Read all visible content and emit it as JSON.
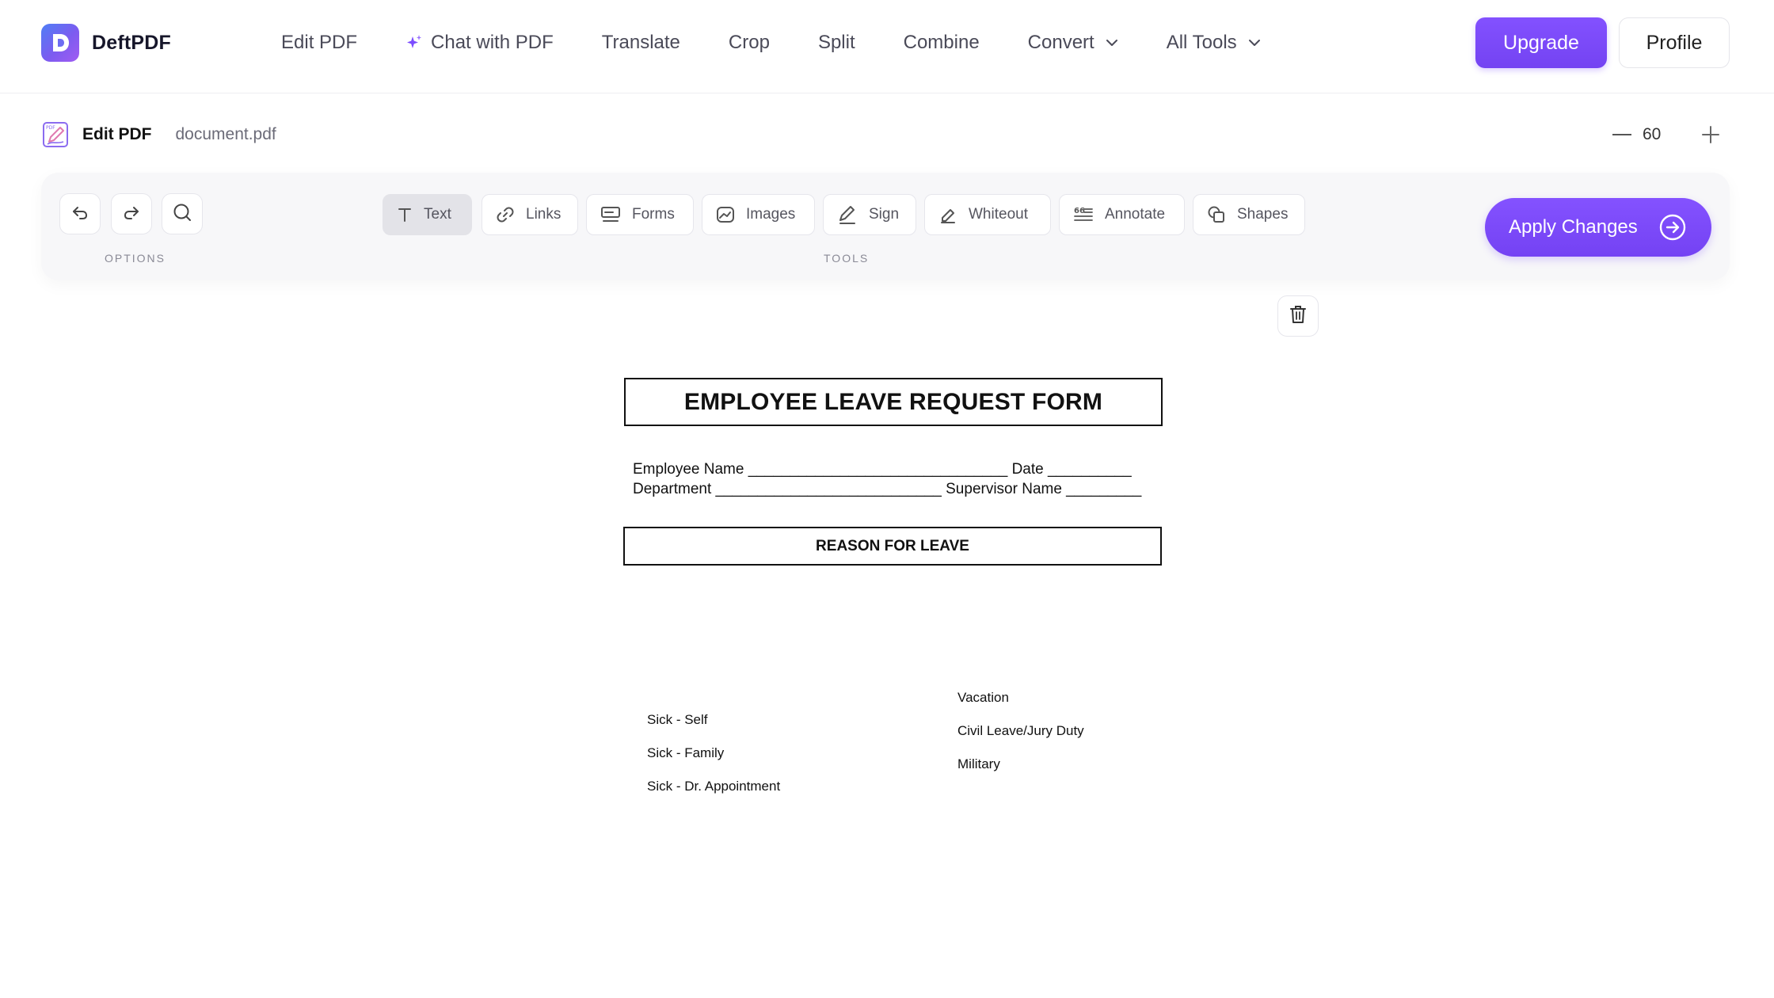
{
  "brand": {
    "name": "DeftPDF",
    "logo_letter": "D"
  },
  "nav": {
    "items": [
      {
        "label": "Edit PDF",
        "icon": null,
        "dropdown": false
      },
      {
        "label": "Chat with PDF",
        "icon": "sparkle-icon",
        "dropdown": false
      },
      {
        "label": "Translate",
        "icon": null,
        "dropdown": false
      },
      {
        "label": "Crop",
        "icon": null,
        "dropdown": false
      },
      {
        "label": "Split",
        "icon": null,
        "dropdown": false
      },
      {
        "label": "Combine",
        "icon": null,
        "dropdown": false
      },
      {
        "label": "Convert",
        "icon": null,
        "dropdown": true
      },
      {
        "label": "All Tools",
        "icon": null,
        "dropdown": true
      }
    ],
    "upgrade_label": "Upgrade",
    "profile_label": "Profile"
  },
  "subheader": {
    "title": "Edit PDF",
    "filename": "document.pdf",
    "zoom_value": "60"
  },
  "toolbar": {
    "options_label": "OPTIONS",
    "tools_label": "TOOLS",
    "options": [
      {
        "name": "undo",
        "icon": "undo-icon"
      },
      {
        "name": "redo",
        "icon": "redo-icon"
      },
      {
        "name": "search",
        "icon": "search-icon"
      }
    ],
    "tools": [
      {
        "label": "Text",
        "icon": "text-icon",
        "active": true
      },
      {
        "label": "Links",
        "icon": "link-icon",
        "active": false
      },
      {
        "label": "Forms",
        "icon": "form-icon",
        "active": false
      },
      {
        "label": "Images",
        "icon": "image-icon",
        "active": false
      },
      {
        "label": "Sign",
        "icon": "pen-icon",
        "active": false
      },
      {
        "label": "Whiteout",
        "icon": "eraser-icon",
        "active": false
      },
      {
        "label": "Annotate",
        "icon": "annotate-icon",
        "active": false
      },
      {
        "label": "Shapes",
        "icon": "shapes-icon",
        "active": false
      }
    ],
    "apply_label": "Apply Changes"
  },
  "document": {
    "title": "EMPLOYEE LEAVE REQUEST FORM",
    "line1": "Employee Name _______________________________ Date __________",
    "line2": "Department ___________________________ Supervisor Name _________",
    "reason_heading": "REASON FOR LEAVE",
    "left_options": [
      "Sick - Self",
      "Sick - Family",
      "Sick - Dr. Appointment"
    ],
    "right_options": [
      "Vacation",
      "Civil Leave/Jury Duty",
      "Military"
    ]
  },
  "colors": {
    "accent": "#7c4dff",
    "text_dark": "#111111",
    "text_muted": "#6b6b78"
  }
}
